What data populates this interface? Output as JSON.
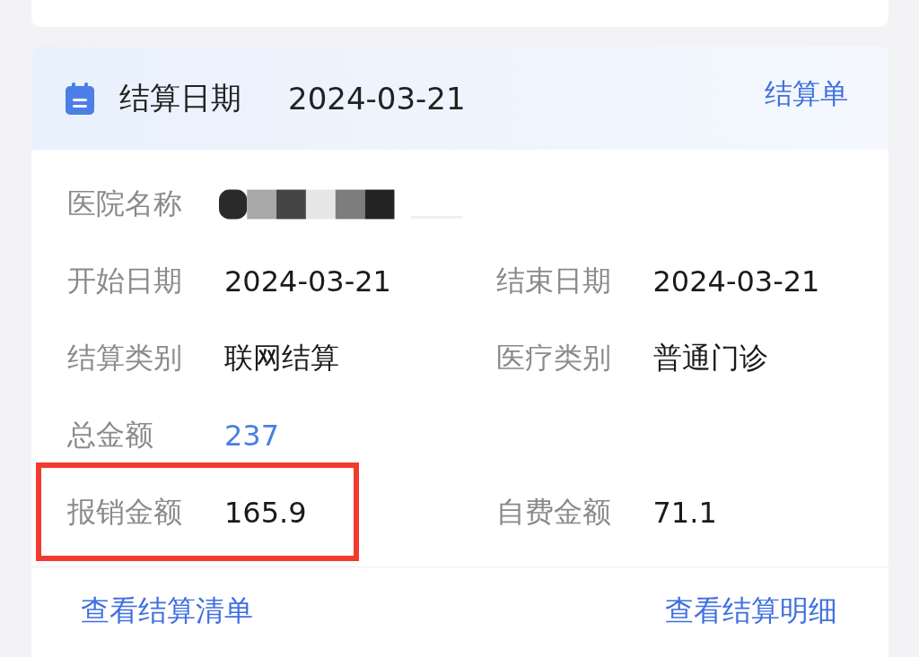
{
  "header": {
    "title": "结算日期",
    "date": "2024-03-21",
    "link": "结算单"
  },
  "rows": [
    [
      {
        "label": "医院名称",
        "kind": "redacted",
        "highlighted": false
      }
    ],
    [
      {
        "label": "开始日期",
        "value": "2024-03-21",
        "kind": "text",
        "highlighted": false
      },
      {
        "label": "结束日期",
        "value": "2024-03-21",
        "kind": "text",
        "highlighted": false
      }
    ],
    [
      {
        "label": "结算类别",
        "value": "联网结算",
        "kind": "text",
        "highlighted": false
      },
      {
        "label": "医疗类别",
        "value": "普通门诊",
        "kind": "text",
        "highlighted": false
      }
    ],
    [
      {
        "label": "总金额",
        "value": "237",
        "kind": "amount",
        "highlighted": false
      }
    ],
    [
      {
        "label": "报销金额",
        "value": "165.9",
        "kind": "text",
        "highlighted": true
      },
      {
        "label": "自费金额",
        "value": "71.1",
        "kind": "text",
        "highlighted": false
      }
    ]
  ],
  "footer": {
    "left_link": "查看结算清单",
    "right_link": "查看结算明细"
  }
}
